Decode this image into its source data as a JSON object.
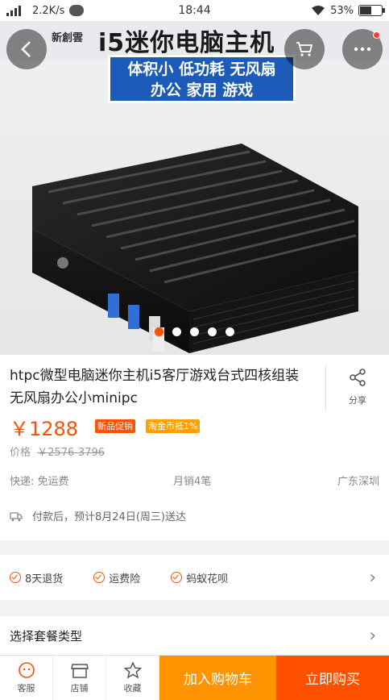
{
  "status_bar": {
    "speed": "2.2K/s",
    "time": "18:44",
    "battery": "53%",
    "battery_level": 0.53
  },
  "hero": {
    "brand": "新創雲",
    "headline": "i5迷你电脑主机",
    "tagline_line1": "体积小 低功耗 无风扇",
    "tagline_line2": "办公 家用 游戏",
    "slide_count": 5,
    "active_slide": 0,
    "accent_color": "#ff5000"
  },
  "nav": {
    "back_icon": "back-chevron-icon",
    "cart_icon": "cart-icon",
    "more_icon": "more-dots-icon"
  },
  "product": {
    "title": "htpc微型电脑迷你主机i5客厅游戏台式四核组装无风扇办公小minipc",
    "share_label": "分享",
    "price": "￥1288",
    "badges": [
      "新品促销",
      "淘金币抵1%"
    ],
    "original_price_label": "价格",
    "original_price": "￥2576-3796",
    "shipping": "快递: 免运费",
    "monthly_sales": "月销4笔",
    "location": "广东深圳",
    "delivery_note": "付款后，预计8月24日(周三)送达"
  },
  "services": {
    "items": [
      "8天退货",
      "运费险",
      "蚂蚁花呗"
    ]
  },
  "package": {
    "label": "选择套餐类型"
  },
  "bottom_bar": {
    "tabs": [
      "客服",
      "店铺",
      "收藏"
    ],
    "add_to_cart": "加入购物车",
    "buy_now": "立即购买",
    "add_to_cart_color": "#ff9402",
    "buy_now_color": "#ff5000"
  }
}
